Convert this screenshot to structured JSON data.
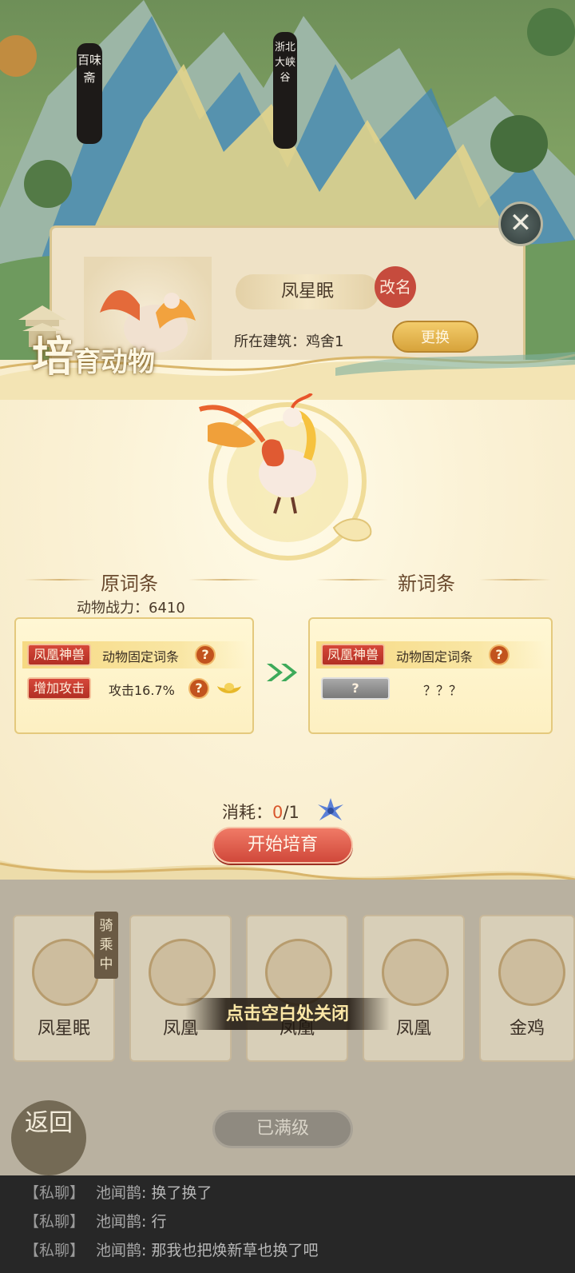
{
  "background": {
    "sign_left": "百味斋",
    "sign_right": "浙北大峡谷"
  },
  "pet_panel": {
    "pet_name": "凤星眠",
    "rename_label": "改名",
    "building_label": "所在建筑：鸡舍1",
    "change_label": "更换"
  },
  "modal": {
    "title_big": "培",
    "title_rest": "育动物",
    "old_title": "原词条",
    "new_title": "新词条",
    "power_label": "动物战力：",
    "power_value": "6410",
    "old_traits": [
      {
        "tag": "凤凰神兽",
        "desc": "动物固定词条"
      },
      {
        "tag": "增加攻击",
        "desc": "攻击16.7%"
      }
    ],
    "new_traits": [
      {
        "tag": "凤凰神兽",
        "desc": "动物固定词条"
      },
      {
        "tag": "?",
        "desc": "？？？"
      }
    ],
    "help_glyph": "?",
    "cost_label": "消耗：",
    "cost_have": "0",
    "cost_need": "/1",
    "start_label": "开始培育"
  },
  "animals": [
    {
      "name": "凤星眠"
    },
    {
      "name": "凤凰"
    },
    {
      "name": "凤凰"
    },
    {
      "name": "凤凰"
    },
    {
      "name": "金鸡"
    }
  ],
  "riding_label": "骑乘中",
  "toast": "点击空白处关闭",
  "maxed_label": "已满级",
  "back_label": "返回",
  "chat": [
    {
      "channel": "【私聊】",
      "sender": "池闻鹊",
      "message": "换了换了"
    },
    {
      "channel": "【私聊】",
      "sender": "池闻鹊",
      "message": "行"
    },
    {
      "channel": "【私聊】",
      "sender": "池闻鹊",
      "message": "那我也把焕新草也换了吧"
    }
  ],
  "colors": {
    "tag_red": "#c23a2d",
    "accent_gold": "#e4c97d",
    "button_red": "#d8562c",
    "chat_bg": "#272727"
  }
}
